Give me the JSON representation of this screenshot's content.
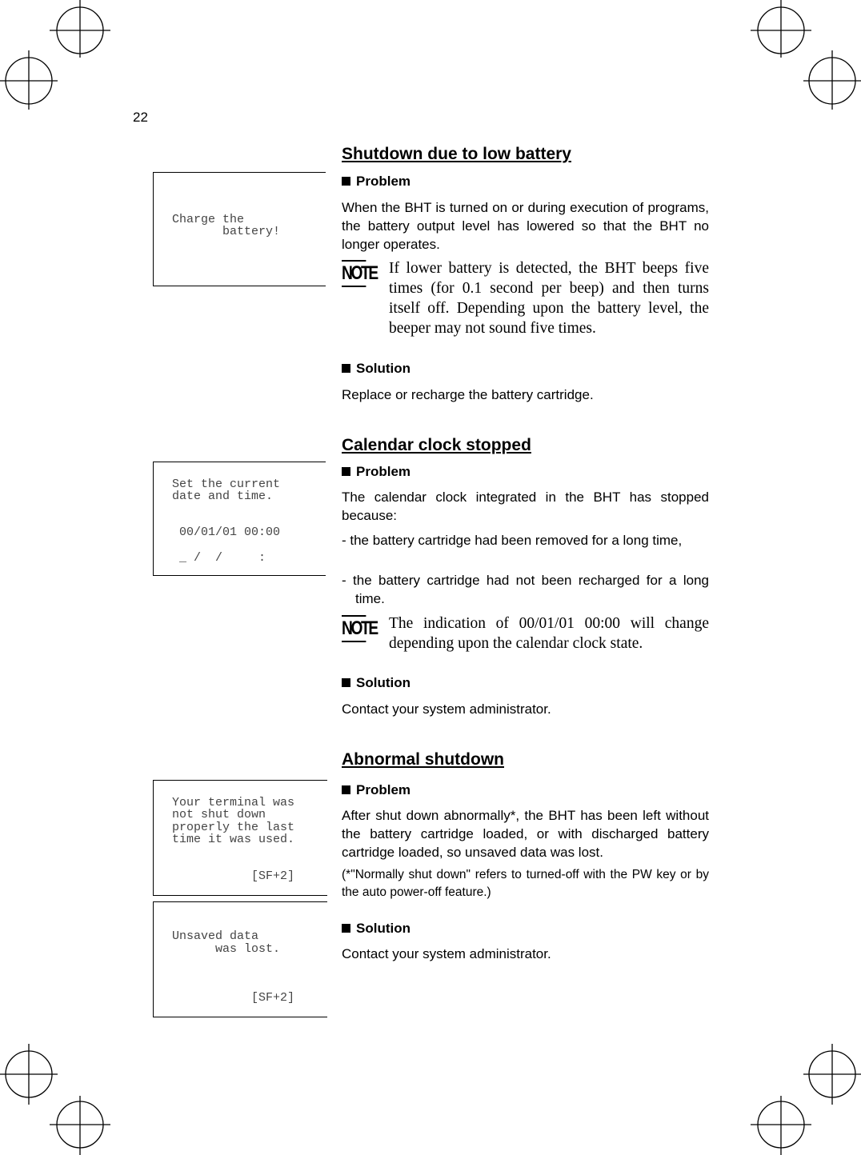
{
  "page_number": "22",
  "sections": [
    {
      "title": "Shutdown due to low battery",
      "problem_label": "Problem",
      "problem_text": "When the BHT is turned on or during execution of programs, the battery output level has lowered so that the BHT no longer operates.",
      "note": "If lower battery is detected, the BHT beeps five times (for 0.1 second per beep) and then turns itself off. Depending upon the battery level, the beeper may not sound five times.",
      "solution_label": "Solution",
      "solution_text": "Replace or recharge the battery cartridge.",
      "screen": [
        "Charge the",
        "       battery!"
      ]
    },
    {
      "title": "Calendar clock stopped",
      "problem_label": "Problem",
      "problem_text": "The calendar clock integrated in the BHT has stopped because:",
      "bullets": [
        "- the battery cartridge had been removed for a long time,",
        "- the battery cartridge had not been recharged for a long time."
      ],
      "note": "The indication of 00/01/01 00:00 will change depending upon the calendar clock state.",
      "solution_label": "Solution",
      "solution_text": "Contact your system administrator.",
      "screen": [
        "Set the current",
        "date and time.",
        " 00/01/01 00:00",
        " _ /  /     :"
      ]
    },
    {
      "title": "Abnormal shutdown",
      "problem_label": "Problem",
      "problem_text": "After shut down abnormally*, the BHT has been left without the battery cartridge loaded, or with discharged battery cartridge loaded, so unsaved data was lost.",
      "footnote": "(*\"Normally shut down\" refers to turned-off with the PW key or by the auto power-off feature.)",
      "solution_label": "Solution",
      "solution_text": "Contact your system administrator.",
      "screen1": [
        "Your terminal was",
        "not shut down",
        "properly the last",
        "time it was used.",
        "           [SF+2]"
      ],
      "screen2": [
        "Unsaved data",
        "      was lost.",
        "           [SF+2]"
      ]
    }
  ],
  "note_icon_label": "NOTE"
}
